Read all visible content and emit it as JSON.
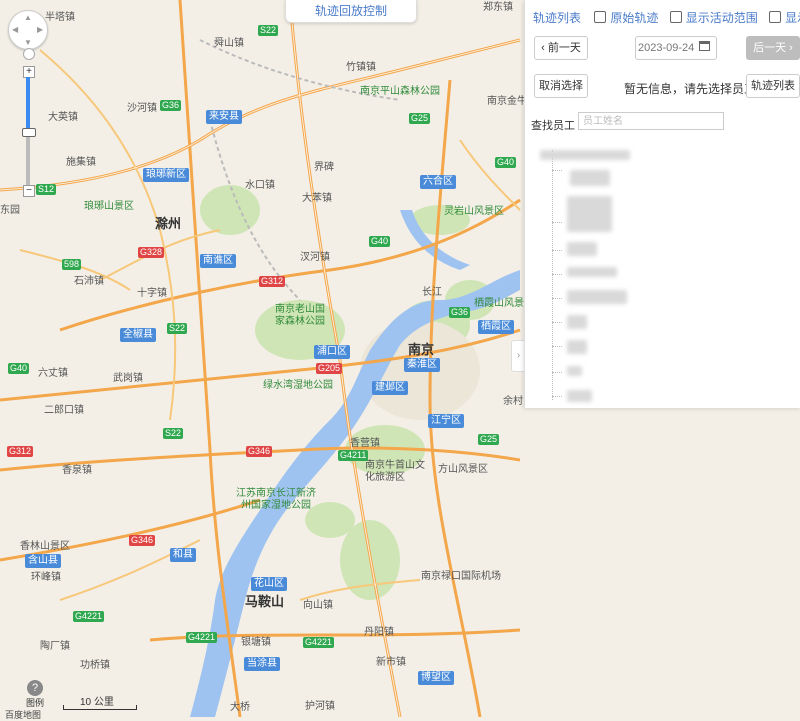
{
  "map": {
    "top_control": "轨迹回放控制",
    "scale_label": "10 公里",
    "legend_label": "图例",
    "attribution": "百度地图",
    "cities": [
      {
        "id": "nanjing",
        "text": "南京"
      },
      {
        "id": "chuzhou",
        "text": "滁州"
      },
      {
        "id": "maanshan",
        "text": "马鞍山"
      }
    ],
    "districts": [
      {
        "id": "laian",
        "text": "来安县"
      },
      {
        "id": "langya",
        "text": "琅琊新区"
      },
      {
        "id": "liuhe",
        "text": "六合区"
      },
      {
        "id": "nanqiao",
        "text": "南谯区"
      },
      {
        "id": "pukou",
        "text": "浦口区"
      },
      {
        "id": "qinhuai",
        "text": "秦淮区"
      },
      {
        "id": "qixia",
        "text": "栖霞区"
      },
      {
        "id": "jianye",
        "text": "建邺区"
      },
      {
        "id": "jiangning",
        "text": "江宁区"
      },
      {
        "id": "quanjiao",
        "text": "全椒县"
      },
      {
        "id": "hexian",
        "text": "和县"
      },
      {
        "id": "huashan",
        "text": "花山区"
      },
      {
        "id": "dangtu",
        "text": "当涂县"
      },
      {
        "id": "bowang",
        "text": "博望区"
      },
      {
        "id": "hanshan",
        "text": "含山县"
      }
    ],
    "places": [
      {
        "id": "p1",
        "text": "半塔镇"
      },
      {
        "id": "p2",
        "text": "舜山镇"
      },
      {
        "id": "p3",
        "text": "竹镇镇"
      },
      {
        "id": "p4",
        "text": "沙河镇"
      },
      {
        "id": "p5",
        "text": "大英镇"
      },
      {
        "id": "p6",
        "text": "施集镇"
      },
      {
        "id": "p7",
        "text": "水口镇"
      },
      {
        "id": "p8",
        "text": "大苯镇"
      },
      {
        "id": "p9",
        "text": "汊河镇"
      },
      {
        "id": "p10",
        "text": "石沛镇"
      },
      {
        "id": "p11",
        "text": "十字镇"
      },
      {
        "id": "p12",
        "text": "六丈镇"
      },
      {
        "id": "p13",
        "text": "武岗镇"
      },
      {
        "id": "p14",
        "text": "二郎口镇"
      },
      {
        "id": "p15",
        "text": "香泉镇"
      },
      {
        "id": "p16",
        "text": "环峰镇"
      },
      {
        "id": "p17",
        "text": "陶厂镇"
      },
      {
        "id": "p18",
        "text": "功桥镇"
      },
      {
        "id": "p19",
        "text": "向山镇"
      },
      {
        "id": "p20",
        "text": "丹阳镇"
      },
      {
        "id": "p21",
        "text": "新市镇"
      },
      {
        "id": "p22",
        "text": "护河镇"
      },
      {
        "id": "p23",
        "text": "银塘镇"
      },
      {
        "id": "p24",
        "text": "长江"
      },
      {
        "id": "p25",
        "text": "余村"
      },
      {
        "id": "p26",
        "text": "界碑"
      },
      {
        "id": "p27",
        "text": "香营镇"
      },
      {
        "id": "p28",
        "text": "南京金牛"
      },
      {
        "id": "p29",
        "text": "郑东镇"
      },
      {
        "id": "p30",
        "text": "东园"
      },
      {
        "id": "p31",
        "text": "大桥"
      }
    ],
    "pois": [
      {
        "id": "poi1",
        "text": "南京平山森林公园"
      },
      {
        "id": "poi2",
        "text": "琅琊山景区"
      },
      {
        "id": "poi3",
        "text": "灵岩山风景区"
      },
      {
        "id": "poi4",
        "text": "南京老山国家森林公园"
      },
      {
        "id": "poi5",
        "text": "栖霞山风景区"
      },
      {
        "id": "poi6",
        "text": "绿水湾湿地公园"
      },
      {
        "id": "poi7",
        "text": "南京牛首山文化旅游区"
      },
      {
        "id": "poi8",
        "text": "方山风景区"
      },
      {
        "id": "poi9",
        "text": "江苏南京长江新济州国家湿地公园"
      },
      {
        "id": "poi10",
        "text": "香林山景区"
      },
      {
        "id": "poi11",
        "text": "南京禄口国际机场"
      }
    ],
    "roads": [
      {
        "id": "r1",
        "text": "S22",
        "kind": "g"
      },
      {
        "id": "r2",
        "text": "G36",
        "kind": "g"
      },
      {
        "id": "r3",
        "text": "G25",
        "kind": "g"
      },
      {
        "id": "r4",
        "text": "S12",
        "kind": "g"
      },
      {
        "id": "r5",
        "text": "G40",
        "kind": "g"
      },
      {
        "id": "r6",
        "text": "G328",
        "kind": "r"
      },
      {
        "id": "r7",
        "text": "G312",
        "kind": "r"
      },
      {
        "id": "r8",
        "text": "598",
        "kind": "g"
      },
      {
        "id": "r9",
        "text": "G40",
        "kind": "g"
      },
      {
        "id": "r10",
        "text": "S22",
        "kind": "g"
      },
      {
        "id": "r11",
        "text": "G205",
        "kind": "r"
      },
      {
        "id": "r12",
        "text": "S22",
        "kind": "g"
      },
      {
        "id": "r13",
        "text": "G346",
        "kind": "r"
      },
      {
        "id": "r14",
        "text": "G4211",
        "kind": "g"
      },
      {
        "id": "r15",
        "text": "G4221",
        "kind": "g"
      },
      {
        "id": "r16",
        "text": "G4221",
        "kind": "g"
      },
      {
        "id": "r17",
        "text": "G346",
        "kind": "r"
      },
      {
        "id": "r18",
        "text": "G312",
        "kind": "r"
      },
      {
        "id": "r19",
        "text": "G40",
        "kind": "g"
      },
      {
        "id": "r20",
        "text": "G25",
        "kind": "g"
      },
      {
        "id": "r21",
        "text": "G36",
        "kind": "g"
      },
      {
        "id": "r22",
        "text": "G4221",
        "kind": "g"
      }
    ]
  },
  "panel": {
    "tab_title": "轨迹列表",
    "checkboxes": [
      {
        "label": "原始轨迹",
        "checked": false
      },
      {
        "label": "显示活动范围",
        "checked": false
      },
      {
        "label": "显示客户",
        "checked": false
      }
    ],
    "prev_day": "前一天",
    "next_day": "后一天",
    "date_value": "2023-09-24",
    "cancel_select": "取消选择",
    "info_text": "暂无信息，请先选择员工",
    "track_list_button": "轨迹列表",
    "find_employee_label": "查找员工",
    "find_employee_placeholder": "员工姓名"
  }
}
